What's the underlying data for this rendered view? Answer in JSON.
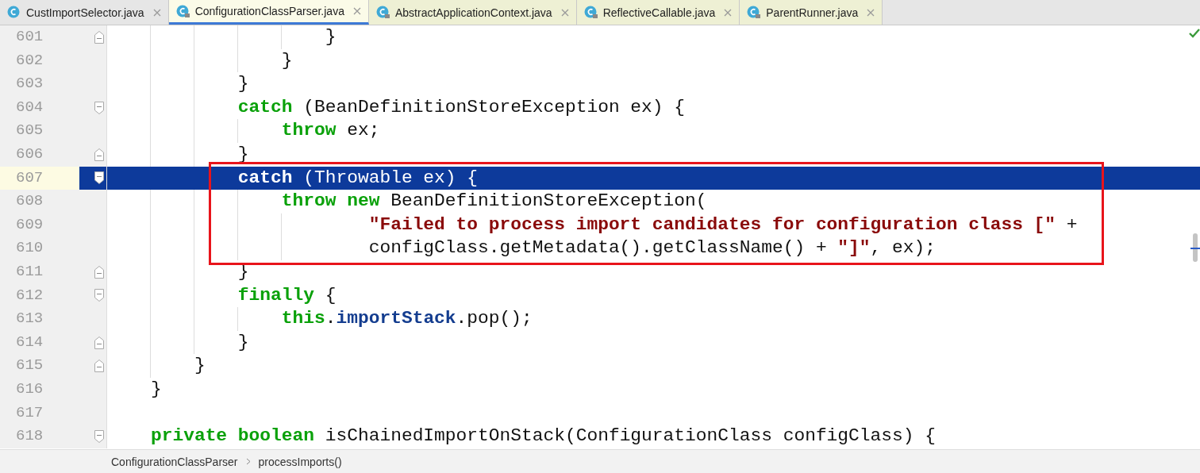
{
  "tabs": [
    {
      "label": "CustImportSelector.java",
      "selected": false,
      "tinted": false,
      "locked": false
    },
    {
      "label": "ConfigurationClassParser.java",
      "selected": true,
      "tinted": false,
      "locked": true
    },
    {
      "label": "AbstractApplicationContext.java",
      "selected": false,
      "tinted": true,
      "locked": true
    },
    {
      "label": "ReflectiveCallable.java",
      "selected": false,
      "tinted": true,
      "locked": true
    },
    {
      "label": "ParentRunner.java",
      "selected": false,
      "tinted": true,
      "locked": true
    }
  ],
  "editor": {
    "lines": [
      {
        "number": "601",
        "fold_start": false,
        "fold_end": true,
        "selected": false,
        "tokens": [
          {
            "kind": "plain",
            "text": "                    }"
          }
        ]
      },
      {
        "number": "602",
        "fold_start": false,
        "fold_end": false,
        "selected": false,
        "tokens": [
          {
            "kind": "plain",
            "text": "                }"
          }
        ]
      },
      {
        "number": "603",
        "fold_start": false,
        "fold_end": false,
        "selected": false,
        "tokens": [
          {
            "kind": "plain",
            "text": "            }"
          }
        ]
      },
      {
        "number": "604",
        "fold_start": true,
        "fold_end": false,
        "selected": false,
        "tokens": [
          {
            "kind": "keyword",
            "text": "            catch"
          },
          {
            "kind": "plain",
            "text": " (BeanDefinitionStoreException ex) {"
          }
        ]
      },
      {
        "number": "605",
        "fold_start": false,
        "fold_end": false,
        "selected": false,
        "tokens": [
          {
            "kind": "keyword",
            "text": "                throw"
          },
          {
            "kind": "plain",
            "text": " ex;"
          }
        ]
      },
      {
        "number": "606",
        "fold_start": false,
        "fold_end": true,
        "selected": false,
        "tokens": [
          {
            "kind": "plain",
            "text": "            }"
          }
        ]
      },
      {
        "number": "607",
        "fold_start": true,
        "fold_end": false,
        "selected": true,
        "tokens": [
          {
            "kind": "keyword",
            "text": "            catch"
          },
          {
            "kind": "plain",
            "text": " (Throwable ex) {"
          }
        ]
      },
      {
        "number": "608",
        "fold_start": false,
        "fold_end": false,
        "selected": false,
        "tokens": [
          {
            "kind": "keyword",
            "text": "                throw new"
          },
          {
            "kind": "plain",
            "text": " BeanDefinitionStoreException("
          }
        ]
      },
      {
        "number": "609",
        "fold_start": false,
        "fold_end": false,
        "selected": false,
        "tokens": [
          {
            "kind": "string",
            "text": "                        \"Failed to process import candidates for configuration class [\""
          },
          {
            "kind": "plain",
            "text": " +"
          }
        ]
      },
      {
        "number": "610",
        "fold_start": false,
        "fold_end": false,
        "selected": false,
        "tokens": [
          {
            "kind": "plain",
            "text": "                        configClass.getMetadata().getClassName() + "
          },
          {
            "kind": "string",
            "text": "\"]\""
          },
          {
            "kind": "plain",
            "text": ", ex);"
          }
        ]
      },
      {
        "number": "611",
        "fold_start": false,
        "fold_end": true,
        "selected": false,
        "tokens": [
          {
            "kind": "plain",
            "text": "            }"
          }
        ]
      },
      {
        "number": "612",
        "fold_start": true,
        "fold_end": false,
        "selected": false,
        "tokens": [
          {
            "kind": "keyword",
            "text": "            finally"
          },
          {
            "kind": "plain",
            "text": " {"
          }
        ]
      },
      {
        "number": "613",
        "fold_start": false,
        "fold_end": false,
        "selected": false,
        "tokens": [
          {
            "kind": "keyword",
            "text": "                this"
          },
          {
            "kind": "plain",
            "text": "."
          },
          {
            "kind": "field",
            "text": "importStack"
          },
          {
            "kind": "plain",
            "text": ".pop();"
          }
        ]
      },
      {
        "number": "614",
        "fold_start": false,
        "fold_end": true,
        "selected": false,
        "tokens": [
          {
            "kind": "plain",
            "text": "            }"
          }
        ]
      },
      {
        "number": "615",
        "fold_start": false,
        "fold_end": true,
        "selected": false,
        "tokens": [
          {
            "kind": "plain",
            "text": "        }"
          }
        ]
      },
      {
        "number": "616",
        "fold_start": false,
        "fold_end": false,
        "selected": false,
        "tokens": [
          {
            "kind": "plain",
            "text": "    }"
          }
        ]
      },
      {
        "number": "617",
        "fold_start": false,
        "fold_end": false,
        "selected": false
      },
      {
        "number": "618",
        "fold_start": true,
        "fold_end": false,
        "selected": false,
        "tokens": [
          {
            "kind": "keyword",
            "text": "    private boolean"
          },
          {
            "kind": "plain",
            "text": " isChainedImportOnStack(ConfigurationClass configClass) {"
          }
        ]
      }
    ]
  },
  "breadcrumbs": [
    "ConfigurationClassParser",
    "processImports()"
  ]
}
